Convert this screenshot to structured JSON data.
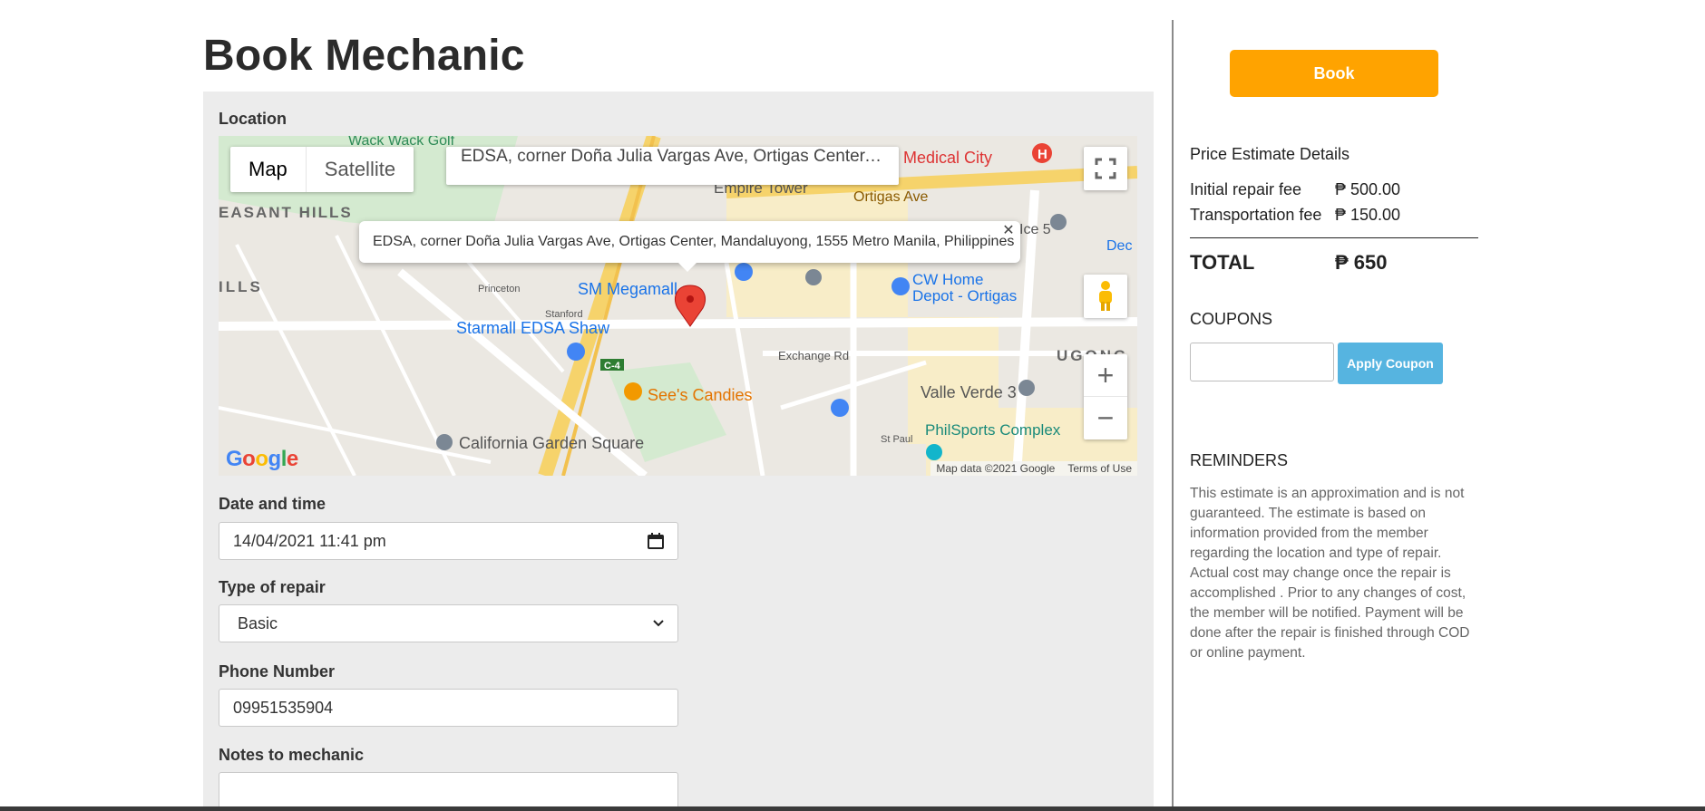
{
  "page": {
    "title": "Book Mechanic"
  },
  "form": {
    "location_label": "Location",
    "date_label": "Date and time",
    "date_value": "14/04/2021 11:41 pm",
    "repair_label": "Type of repair",
    "repair_value": "Basic",
    "phone_label": "Phone Number",
    "phone_value": "09951535904",
    "notes_label": "Notes to mechanic",
    "notes_value": ""
  },
  "map": {
    "type_map": "Map",
    "type_satellite": "Satellite",
    "search_value": "EDSA, corner Doña Julia Vargas Ave, Ortigas Center, Ma...",
    "infowindow_text": "EDSA, corner Doña Julia Vargas Ave, Ortigas Center, Mandaluyong, 1555 Metro Manila, Philippines",
    "attribution": "Map data ©2021 Google",
    "terms": "Terms of Use",
    "logo": "Google",
    "places": [
      "Wack Wack Golf",
      "Medical City",
      "Empire Tower",
      "Ortigas Ave",
      "EASANT HILLS",
      "ILLS",
      "SM Megamall",
      "CW Home",
      "Depot - Ortigas",
      "Starmall EDSA Shaw",
      "See's Candies",
      "Exchange Rd",
      "Valle Verde 3",
      "PhilSports Complex",
      "California Garden Square",
      "UGONG",
      "Dec",
      "Ice 5",
      "Princeton",
      "Stanford",
      "C-4",
      "St Paul"
    ]
  },
  "sidebar": {
    "book_label": "Book",
    "price_heading": "Price Estimate Details",
    "initial_fee_label": "Initial repair fee",
    "initial_fee_value": "₱ 500.00",
    "transport_fee_label": "Transportation fee",
    "transport_fee_value": "₱ 150.00",
    "total_label": "TOTAL",
    "total_value": "₱ 650",
    "coupons_heading": "COUPONS",
    "coupon_value": "",
    "apply_coupon_label": "Apply Coupon",
    "reminders_heading": "REMINDERS",
    "reminders_text": "This estimate is an approximation and is not guaranteed. The estimate is based on information provided from the member regarding the location and type of repair. Actual cost may change once the repair is accomplished . Prior to any changes of cost, the member will be notified. Payment will be done after the repair is finished through COD or online payment."
  },
  "colors": {
    "book_button": "#ffa300",
    "apply_button": "#56b4e0",
    "panel_bg": "#ececec"
  }
}
